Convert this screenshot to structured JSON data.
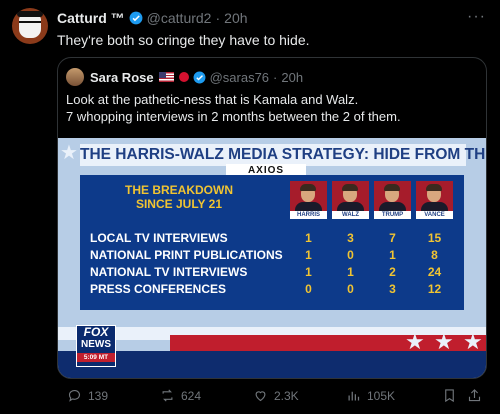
{
  "author": {
    "name": "Catturd ™",
    "handle": "@catturd2",
    "sep": "·",
    "time": "20h"
  },
  "tweet_text": "They're both so cringe they have to hide.",
  "more_label": "···",
  "quoted": {
    "name": "Sara Rose",
    "handle": "@saras76",
    "sep": "·",
    "time": "20h",
    "line1": "Look at the pathetic-ness that is Kamala and Walz.",
    "line2": "7 whopping interviews in 2 months between the 2 of them."
  },
  "graphic": {
    "banner": "THE HARRIS-WALZ MEDIA STRATEGY: HIDE FROM THE PRESS",
    "source": "AXIOS",
    "breakdown_line1": "THE BREAKDOWN",
    "breakdown_line2": "SINCE JULY 21",
    "candidates": [
      "HARRIS",
      "WALZ",
      "TRUMP",
      "VANCE"
    ],
    "rows": [
      {
        "label": "LOCAL TV INTERVIEWS",
        "values": [
          "1",
          "3",
          "7",
          "15"
        ]
      },
      {
        "label": "NATIONAL PRINT PUBLICATIONS",
        "values": [
          "1",
          "0",
          "1",
          "8"
        ]
      },
      {
        "label": "NATIONAL TV INTERVIEWS",
        "values": [
          "1",
          "1",
          "2",
          "24"
        ]
      },
      {
        "label": "PRESS CONFERENCES",
        "values": [
          "0",
          "0",
          "3",
          "12"
        ]
      }
    ],
    "network_line1": "FOX",
    "network_line2": "NEWS",
    "clock": "5:09 MT"
  },
  "actions": {
    "replies": "139",
    "reposts": "624",
    "likes": "2.3K",
    "views": "105K"
  },
  "colors": {
    "background": "#000000",
    "muted": "#71767b",
    "verified": "#1d9bf0",
    "gold": "#f1c432",
    "panel": "#0d3a8a"
  }
}
